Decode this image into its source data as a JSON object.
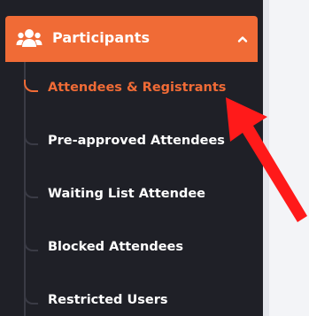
{
  "colors": {
    "accent": "#f06b36",
    "sidebar_bg": "#1f2027",
    "text": "#ffffff",
    "arrow": "#ff1a1a"
  },
  "section": {
    "label": "Participants",
    "icon": "users-group-icon",
    "expanded": true,
    "chevron_icon": "chevron-up-icon"
  },
  "sub_items": [
    {
      "label": "Attendees & Registrants",
      "active": true
    },
    {
      "label": "Pre-approved Attendees",
      "active": false
    },
    {
      "label": "Waiting List Attendee",
      "active": false
    },
    {
      "label": "Blocked Attendees",
      "active": false
    },
    {
      "label": "Restricted Users",
      "active": false
    }
  ],
  "annotation": {
    "icon": "red-pointer-arrow"
  }
}
